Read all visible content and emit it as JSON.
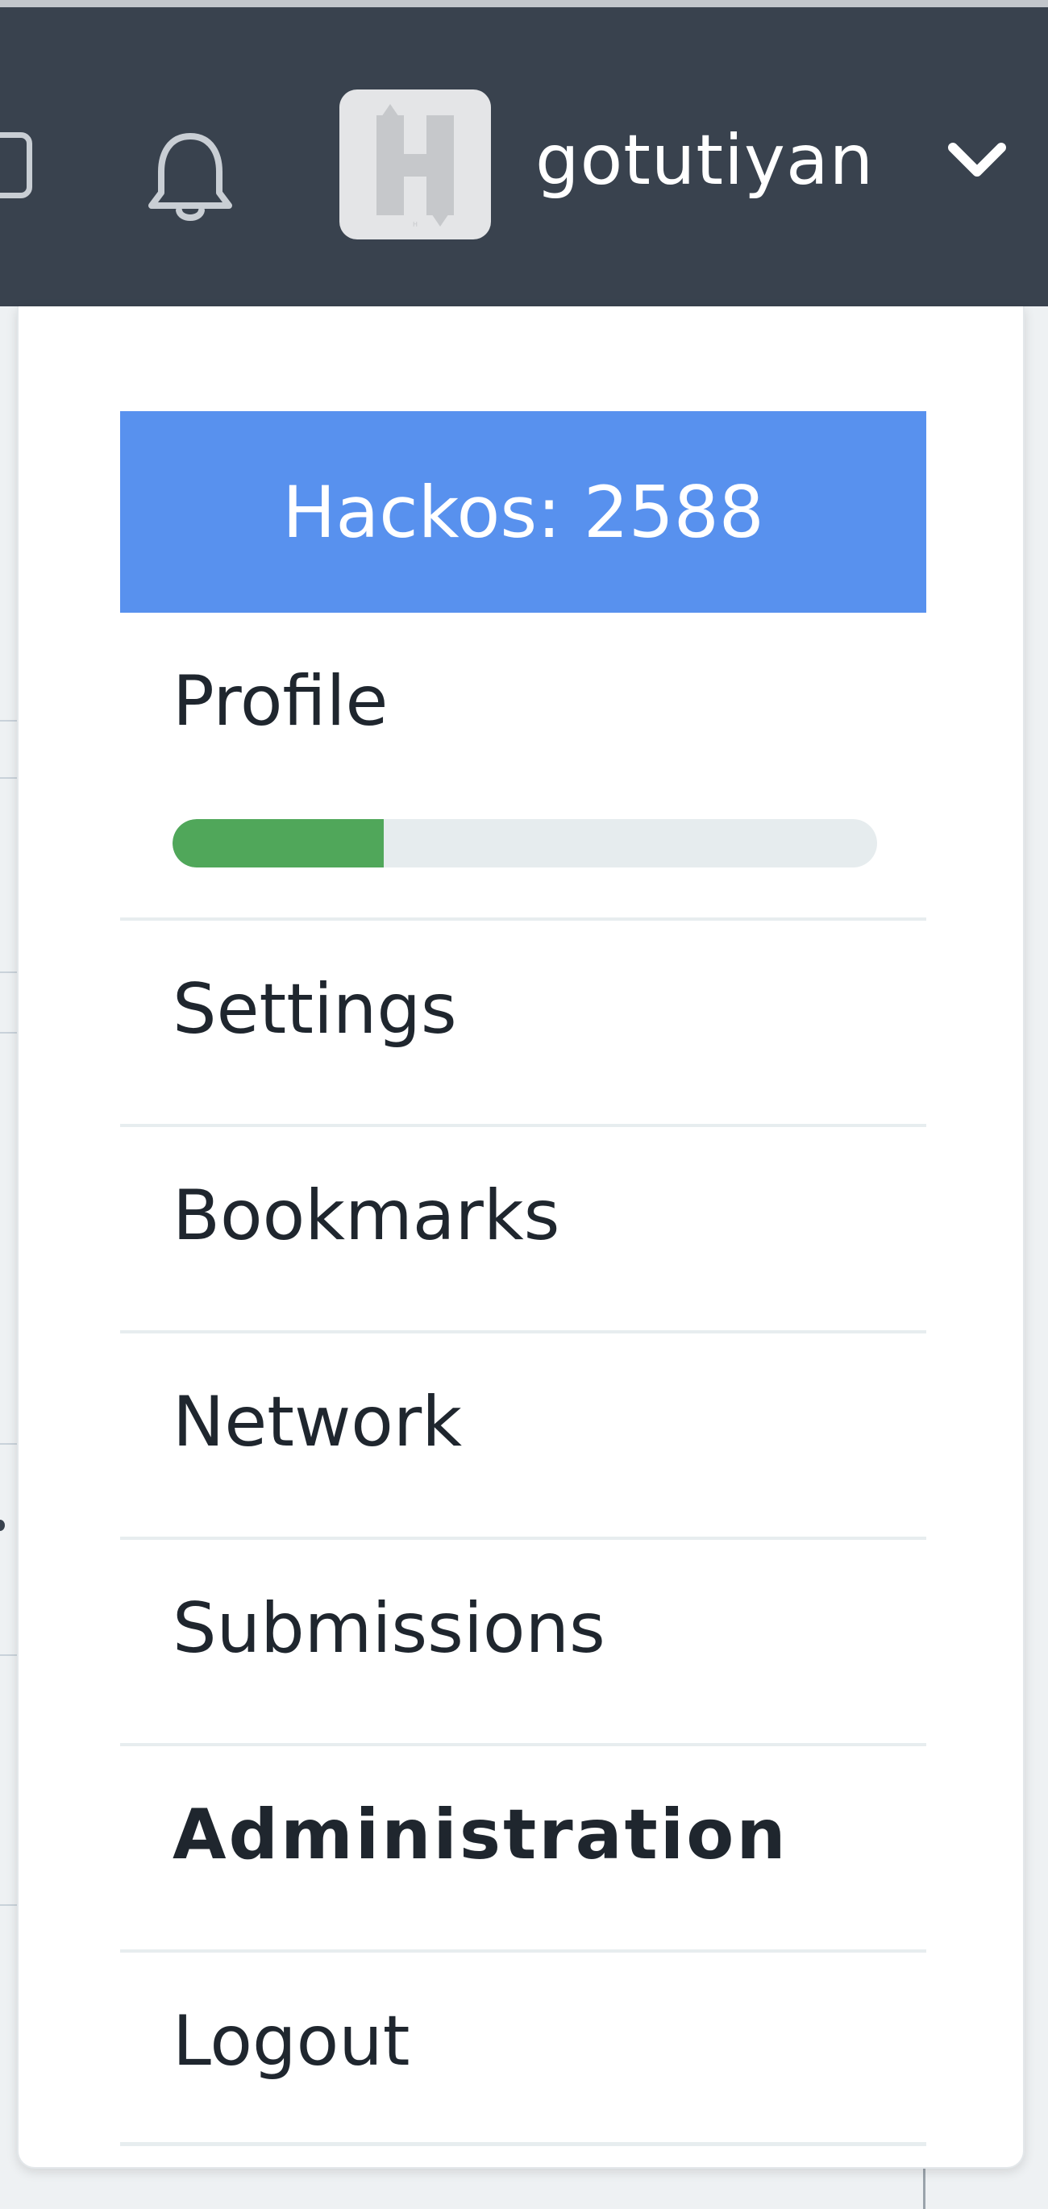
{
  "topbar": {
    "username": "gotutiyan",
    "avatar_letter": "H"
  },
  "dropdown": {
    "hackos_label": "Hackos: 2588",
    "profile": {
      "label": "Profile",
      "completion_fraction": 0.3
    },
    "items": [
      {
        "label": "Settings"
      },
      {
        "label": "Bookmarks"
      },
      {
        "label": "Network"
      },
      {
        "label": "Submissions"
      },
      {
        "label": "Administration"
      },
      {
        "label": "Logout"
      }
    ]
  },
  "colors": {
    "topbar_bg": "#39424e",
    "hackos_bg": "#5891ee",
    "progress_fill": "#50a75a",
    "progress_track": "#e6ecee"
  },
  "icons": [
    "bell-icon",
    "chevron-down-icon",
    "square-icon"
  ]
}
